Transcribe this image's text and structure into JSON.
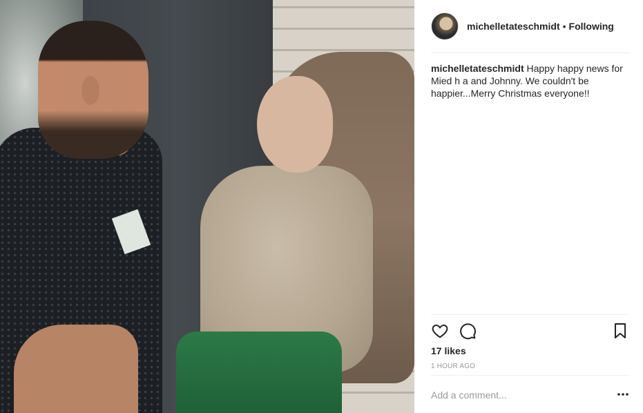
{
  "post": {
    "username": "michelletateschmidt",
    "separator": "•",
    "follow_status": "Following",
    "caption_user": "michelletateschmidt",
    "caption_text": "Happy happy news for Mied h a and Johnny. We couldn't be happier...Merry Christmas everyone!!",
    "likes": "17 likes",
    "time_ago": "1 HOUR AGO"
  },
  "comment": {
    "placeholder": "Add a comment..."
  },
  "icons": {
    "like": "heart-icon",
    "comment": "comment-bubble-icon",
    "save": "bookmark-icon",
    "more": "more-options-icon"
  },
  "colors": {
    "text": "#262626",
    "muted": "#999999",
    "divider": "#efefef"
  }
}
